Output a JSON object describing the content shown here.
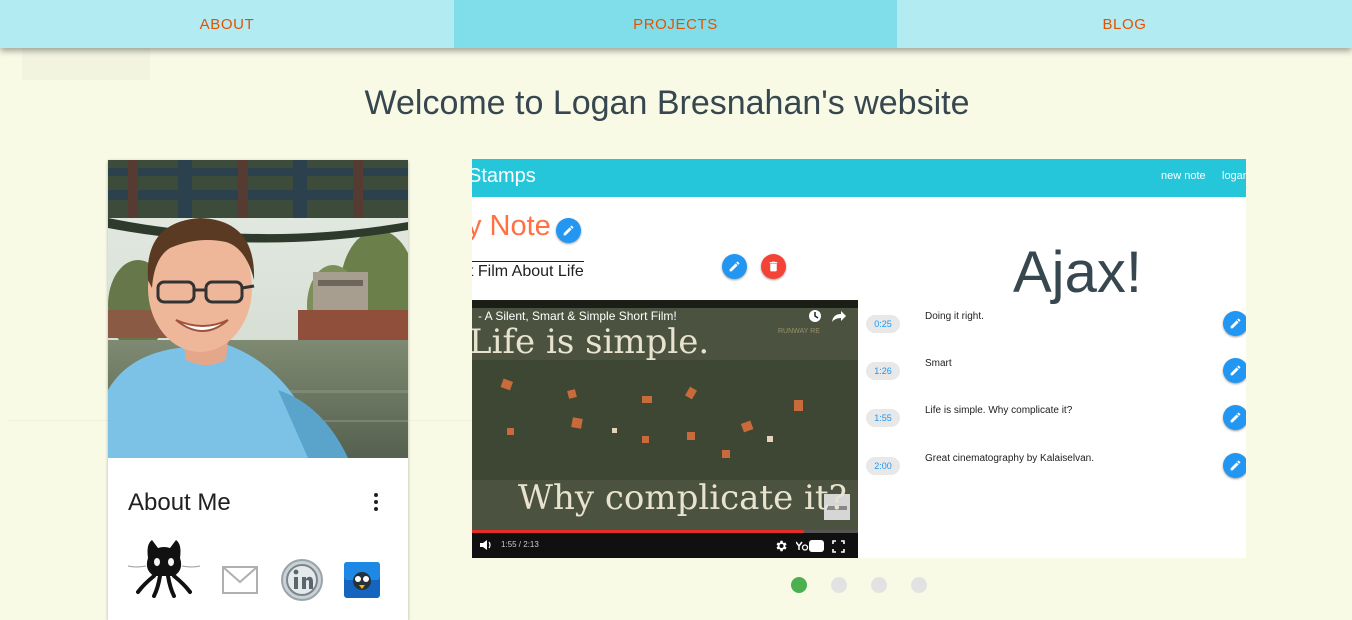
{
  "nav": {
    "tabs": [
      {
        "label": "ABOUT"
      },
      {
        "label": "PROJECTS"
      },
      {
        "label": "BLOG"
      }
    ],
    "active_tab": "PROJECTS"
  },
  "page": {
    "title": "Welcome to Logan Bresnahan's website"
  },
  "about_card": {
    "title": "About Me",
    "social_icons": [
      "github-icon",
      "email-icon",
      "linkedin-icon",
      "blog-icon"
    ]
  },
  "project_slide": {
    "app_brand": "Stamps",
    "nav_links": [
      "new note",
      "logan"
    ],
    "note_title": "y Note",
    "film_name": "t Film About Life",
    "overlay_text": "Ajax!",
    "video": {
      "title": "- A Silent, Smart & Simple Short Film!",
      "caption_1": "Life is simple.",
      "caption_2": "Why complicate it?",
      "time": "1:55 / 2:13",
      "progress": 0.86,
      "channel_mark": "RUNWAY RE"
    },
    "stamps": [
      {
        "time": "0:25",
        "text": "Doing it right."
      },
      {
        "time": "1:26",
        "text": "Smart"
      },
      {
        "time": "1:55",
        "text": "Life is simple. Why complicate it?"
      },
      {
        "time": "2:00",
        "text": "Great cinematography by Kalaiselvan."
      }
    ]
  },
  "carousel": {
    "slide_count": 4,
    "active_index": 0
  },
  "colors": {
    "background": "#f8fae6",
    "nav_bg": "#b2ebf2",
    "nav_active": "#80deea",
    "nav_text": "#e65100",
    "app_bar": "#26c6da",
    "edit_button": "#2196f3",
    "delete_button": "#f44336",
    "note_title": "#ff7043",
    "dot_active": "#4caf50"
  }
}
